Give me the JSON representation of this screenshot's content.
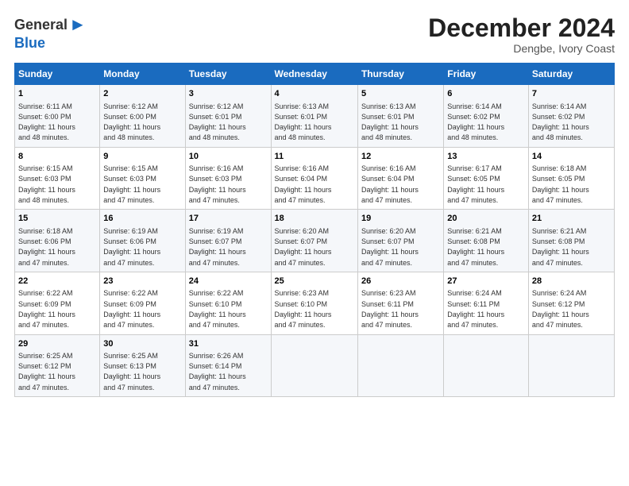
{
  "logo": {
    "general": "General",
    "blue": "Blue"
  },
  "header": {
    "month": "December 2024",
    "location": "Dengbe, Ivory Coast"
  },
  "days_of_week": [
    "Sunday",
    "Monday",
    "Tuesday",
    "Wednesday",
    "Thursday",
    "Friday",
    "Saturday"
  ],
  "weeks": [
    [
      {
        "day": "1",
        "sunrise": "6:11 AM",
        "sunset": "6:00 PM",
        "daylight": "11 hours and 48 minutes."
      },
      {
        "day": "2",
        "sunrise": "6:12 AM",
        "sunset": "6:00 PM",
        "daylight": "11 hours and 48 minutes."
      },
      {
        "day": "3",
        "sunrise": "6:12 AM",
        "sunset": "6:01 PM",
        "daylight": "11 hours and 48 minutes."
      },
      {
        "day": "4",
        "sunrise": "6:13 AM",
        "sunset": "6:01 PM",
        "daylight": "11 hours and 48 minutes."
      },
      {
        "day": "5",
        "sunrise": "6:13 AM",
        "sunset": "6:01 PM",
        "daylight": "11 hours and 48 minutes."
      },
      {
        "day": "6",
        "sunrise": "6:14 AM",
        "sunset": "6:02 PM",
        "daylight": "11 hours and 48 minutes."
      },
      {
        "day": "7",
        "sunrise": "6:14 AM",
        "sunset": "6:02 PM",
        "daylight": "11 hours and 48 minutes."
      }
    ],
    [
      {
        "day": "8",
        "sunrise": "6:15 AM",
        "sunset": "6:03 PM",
        "daylight": "11 hours and 48 minutes."
      },
      {
        "day": "9",
        "sunrise": "6:15 AM",
        "sunset": "6:03 PM",
        "daylight": "11 hours and 47 minutes."
      },
      {
        "day": "10",
        "sunrise": "6:16 AM",
        "sunset": "6:03 PM",
        "daylight": "11 hours and 47 minutes."
      },
      {
        "day": "11",
        "sunrise": "6:16 AM",
        "sunset": "6:04 PM",
        "daylight": "11 hours and 47 minutes."
      },
      {
        "day": "12",
        "sunrise": "6:16 AM",
        "sunset": "6:04 PM",
        "daylight": "11 hours and 47 minutes."
      },
      {
        "day": "13",
        "sunrise": "6:17 AM",
        "sunset": "6:05 PM",
        "daylight": "11 hours and 47 minutes."
      },
      {
        "day": "14",
        "sunrise": "6:18 AM",
        "sunset": "6:05 PM",
        "daylight": "11 hours and 47 minutes."
      }
    ],
    [
      {
        "day": "15",
        "sunrise": "6:18 AM",
        "sunset": "6:06 PM",
        "daylight": "11 hours and 47 minutes."
      },
      {
        "day": "16",
        "sunrise": "6:19 AM",
        "sunset": "6:06 PM",
        "daylight": "11 hours and 47 minutes."
      },
      {
        "day": "17",
        "sunrise": "6:19 AM",
        "sunset": "6:07 PM",
        "daylight": "11 hours and 47 minutes."
      },
      {
        "day": "18",
        "sunrise": "6:20 AM",
        "sunset": "6:07 PM",
        "daylight": "11 hours and 47 minutes."
      },
      {
        "day": "19",
        "sunrise": "6:20 AM",
        "sunset": "6:07 PM",
        "daylight": "11 hours and 47 minutes."
      },
      {
        "day": "20",
        "sunrise": "6:21 AM",
        "sunset": "6:08 PM",
        "daylight": "11 hours and 47 minutes."
      },
      {
        "day": "21",
        "sunrise": "6:21 AM",
        "sunset": "6:08 PM",
        "daylight": "11 hours and 47 minutes."
      }
    ],
    [
      {
        "day": "22",
        "sunrise": "6:22 AM",
        "sunset": "6:09 PM",
        "daylight": "11 hours and 47 minutes."
      },
      {
        "day": "23",
        "sunrise": "6:22 AM",
        "sunset": "6:09 PM",
        "daylight": "11 hours and 47 minutes."
      },
      {
        "day": "24",
        "sunrise": "6:22 AM",
        "sunset": "6:10 PM",
        "daylight": "11 hours and 47 minutes."
      },
      {
        "day": "25",
        "sunrise": "6:23 AM",
        "sunset": "6:10 PM",
        "daylight": "11 hours and 47 minutes."
      },
      {
        "day": "26",
        "sunrise": "6:23 AM",
        "sunset": "6:11 PM",
        "daylight": "11 hours and 47 minutes."
      },
      {
        "day": "27",
        "sunrise": "6:24 AM",
        "sunset": "6:11 PM",
        "daylight": "11 hours and 47 minutes."
      },
      {
        "day": "28",
        "sunrise": "6:24 AM",
        "sunset": "6:12 PM",
        "daylight": "11 hours and 47 minutes."
      }
    ],
    [
      {
        "day": "29",
        "sunrise": "6:25 AM",
        "sunset": "6:12 PM",
        "daylight": "11 hours and 47 minutes."
      },
      {
        "day": "30",
        "sunrise": "6:25 AM",
        "sunset": "6:13 PM",
        "daylight": "11 hours and 47 minutes."
      },
      {
        "day": "31",
        "sunrise": "6:26 AM",
        "sunset": "6:14 PM",
        "daylight": "11 hours and 47 minutes."
      },
      null,
      null,
      null,
      null
    ]
  ]
}
